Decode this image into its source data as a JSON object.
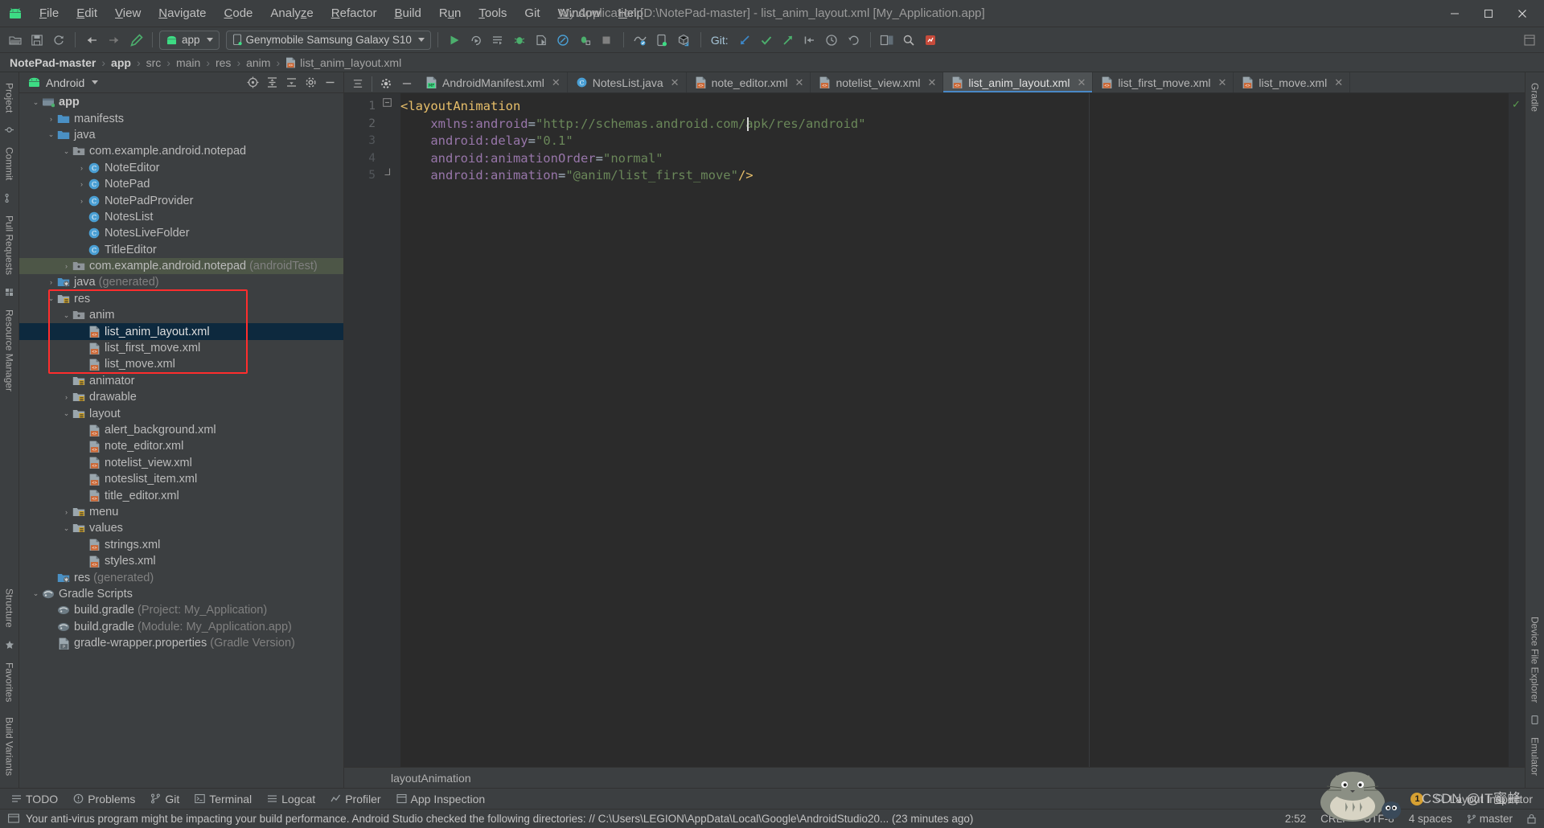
{
  "window": {
    "title": "My Application [D:\\NotePad-master] - list_anim_layout.xml [My_Application.app]",
    "minimize": "—",
    "maximize": "▢",
    "close": "✕",
    "logo_icon": "android-logo-icon"
  },
  "menubar": {
    "items": [
      {
        "label": "File",
        "mnemonic": "F"
      },
      {
        "label": "Edit",
        "mnemonic": "E"
      },
      {
        "label": "View",
        "mnemonic": "V"
      },
      {
        "label": "Navigate",
        "mnemonic": "N"
      },
      {
        "label": "Code",
        "mnemonic": "C"
      },
      {
        "label": "Analyze",
        "mnemonic": "z"
      },
      {
        "label": "Refactor",
        "mnemonic": "R"
      },
      {
        "label": "Build",
        "mnemonic": "B"
      },
      {
        "label": "Run",
        "mnemonic": "u"
      },
      {
        "label": "Tools",
        "mnemonic": "T"
      },
      {
        "label": "Git",
        "mnemonic": ""
      },
      {
        "label": "Window",
        "mnemonic": "W"
      },
      {
        "label": "Help",
        "mnemonic": "H"
      }
    ]
  },
  "toolbar": {
    "open_icon": "open-folder-icon",
    "save_icon": "save-icon",
    "sync_icon": "sync-icon",
    "back_icon": "back-arrow-icon",
    "forward_icon": "forward-arrow-icon",
    "make_icon": "build-hammer-icon",
    "module_selector": "app",
    "module_icon": "android-module-icon",
    "device_selector": "Genymobile Samsung Galaxy S10",
    "device_icon": "phone-icon",
    "run_icon": "run-icon",
    "rerun_icon": "rerun-icon",
    "apply_changes_icon": "apply-changes-icon",
    "debug_icon": "debug-icon",
    "attach_debugger_icon": "attach-debugger-icon",
    "profiler_icon": "profiler-icon",
    "run_coverage_icon": "run-with-coverage-icon",
    "stop_icon": "stop-icon",
    "sdk_manager_icon": "sdk-manager-icon",
    "avd_manager_icon": "avd-manager-icon",
    "layout_inspector_icon": "device-manager-icon",
    "git_label": "Git:",
    "git_update_icon": "git-update-icon",
    "git_commit_icon": "git-commit-icon",
    "git_push_icon": "git-push-icon",
    "git_history_icon": "git-history-icon",
    "history_icon": "history-clock-icon",
    "undo_icon": "undo-icon",
    "device_explorer_icon": "device-file-explorer-icon",
    "search_icon": "search-everywhere-icon",
    "profile_icon": "profiler-red-icon",
    "layout_icon": "layout-icon"
  },
  "breadcrumb": {
    "items": [
      {
        "label": "NotePad-master",
        "bold": true,
        "icon": ""
      },
      {
        "label": "app",
        "bold": true,
        "icon": ""
      },
      {
        "label": "src",
        "bold": false,
        "icon": ""
      },
      {
        "label": "main",
        "bold": false,
        "icon": ""
      },
      {
        "label": "res",
        "bold": false,
        "icon": ""
      },
      {
        "label": "anim",
        "bold": false,
        "icon": ""
      },
      {
        "label": "list_anim_layout.xml",
        "bold": false,
        "icon": "xml-file-icon"
      }
    ],
    "separator": "›"
  },
  "project_panel": {
    "title": "Android",
    "title_icon": "android-head-icon",
    "caret": "▾",
    "header_icons": [
      "target-icon",
      "collapse-all-icon",
      "expand-icon",
      "settings-gear-icon",
      "hide-icon"
    ],
    "tree": [
      {
        "depth": 0,
        "arrow": "v",
        "icon": "module-icon",
        "label": "app",
        "suffix": "",
        "bold": true,
        "state": "normal"
      },
      {
        "depth": 1,
        "arrow": ">",
        "icon": "folder-blue-icon",
        "label": "manifests",
        "suffix": "",
        "bold": false,
        "state": "normal"
      },
      {
        "depth": 1,
        "arrow": "v",
        "icon": "folder-blue-icon",
        "label": "java",
        "suffix": "",
        "bold": false,
        "state": "normal"
      },
      {
        "depth": 2,
        "arrow": "v",
        "icon": "package-icon",
        "label": "com.example.android.notepad",
        "suffix": "",
        "bold": false,
        "state": "normal"
      },
      {
        "depth": 3,
        "arrow": ">",
        "icon": "class-icon",
        "label": "NoteEditor",
        "suffix": "",
        "bold": false,
        "state": "normal"
      },
      {
        "depth": 3,
        "arrow": ">",
        "icon": "class-icon",
        "label": "NotePad",
        "suffix": "",
        "bold": false,
        "state": "normal"
      },
      {
        "depth": 3,
        "arrow": ">",
        "icon": "class-icon",
        "label": "NotePadProvider",
        "suffix": "",
        "bold": false,
        "state": "normal"
      },
      {
        "depth": 3,
        "arrow": "",
        "icon": "class-icon",
        "label": "NotesList",
        "suffix": "",
        "bold": false,
        "state": "normal"
      },
      {
        "depth": 3,
        "arrow": "",
        "icon": "class-icon",
        "label": "NotesLiveFolder",
        "suffix": "",
        "bold": false,
        "state": "normal"
      },
      {
        "depth": 3,
        "arrow": "",
        "icon": "class-icon",
        "label": "TitleEditor",
        "suffix": "",
        "bold": false,
        "state": "normal"
      },
      {
        "depth": 2,
        "arrow": ">",
        "icon": "package-icon",
        "label": "com.example.android.notepad",
        "suffix": " (androidTest)",
        "bold": false,
        "state": "test"
      },
      {
        "depth": 1,
        "arrow": ">",
        "icon": "folder-gen-icon",
        "label": "java",
        "suffix": " (generated)",
        "bold": false,
        "state": "normal"
      },
      {
        "depth": 1,
        "arrow": "v",
        "icon": "folder-res-icon",
        "label": "res",
        "suffix": "",
        "bold": false,
        "state": "normal"
      },
      {
        "depth": 2,
        "arrow": "v",
        "icon": "package-icon",
        "label": "anim",
        "suffix": "",
        "bold": false,
        "state": "normal"
      },
      {
        "depth": 3,
        "arrow": "",
        "icon": "xml-file-icon",
        "label": "list_anim_layout.xml",
        "suffix": "",
        "bold": false,
        "state": "selected"
      },
      {
        "depth": 3,
        "arrow": "",
        "icon": "xml-file-icon",
        "label": "list_first_move.xml",
        "suffix": "",
        "bold": false,
        "state": "normal"
      },
      {
        "depth": 3,
        "arrow": "",
        "icon": "xml-file-icon",
        "label": "list_move.xml",
        "suffix": "",
        "bold": false,
        "state": "normal"
      },
      {
        "depth": 2,
        "arrow": "",
        "icon": "folder-res-icon",
        "label": "animator",
        "suffix": "",
        "bold": false,
        "state": "normal"
      },
      {
        "depth": 2,
        "arrow": ">",
        "icon": "folder-res-icon",
        "label": "drawable",
        "suffix": "",
        "bold": false,
        "state": "normal"
      },
      {
        "depth": 2,
        "arrow": "v",
        "icon": "folder-res-icon",
        "label": "layout",
        "suffix": "",
        "bold": false,
        "state": "normal"
      },
      {
        "depth": 3,
        "arrow": "",
        "icon": "xml-file-icon",
        "label": "alert_background.xml",
        "suffix": "",
        "bold": false,
        "state": "normal"
      },
      {
        "depth": 3,
        "arrow": "",
        "icon": "xml-file-icon",
        "label": "note_editor.xml",
        "suffix": "",
        "bold": false,
        "state": "normal"
      },
      {
        "depth": 3,
        "arrow": "",
        "icon": "xml-file-icon",
        "label": "notelist_view.xml",
        "suffix": "",
        "bold": false,
        "state": "normal"
      },
      {
        "depth": 3,
        "arrow": "",
        "icon": "xml-file-icon",
        "label": "noteslist_item.xml",
        "suffix": "",
        "bold": false,
        "state": "normal"
      },
      {
        "depth": 3,
        "arrow": "",
        "icon": "xml-file-icon",
        "label": "title_editor.xml",
        "suffix": "",
        "bold": false,
        "state": "normal"
      },
      {
        "depth": 2,
        "arrow": ">",
        "icon": "folder-res-icon",
        "label": "menu",
        "suffix": "",
        "bold": false,
        "state": "normal"
      },
      {
        "depth": 2,
        "arrow": "v",
        "icon": "folder-res-icon",
        "label": "values",
        "suffix": "",
        "bold": false,
        "state": "normal"
      },
      {
        "depth": 3,
        "arrow": "",
        "icon": "xml-file-icon",
        "label": "strings.xml",
        "suffix": "",
        "bold": false,
        "state": "normal"
      },
      {
        "depth": 3,
        "arrow": "",
        "icon": "xml-file-icon",
        "label": "styles.xml",
        "suffix": "",
        "bold": false,
        "state": "normal"
      },
      {
        "depth": 1,
        "arrow": "",
        "icon": "folder-gen-icon",
        "label": "res",
        "suffix": " (generated)",
        "bold": false,
        "state": "normal"
      },
      {
        "depth": 0,
        "arrow": "v",
        "icon": "gradle-icon",
        "label": "Gradle Scripts",
        "suffix": "",
        "bold": false,
        "state": "normal"
      },
      {
        "depth": 1,
        "arrow": "",
        "icon": "gradle-file-icon",
        "label": "build.gradle",
        "suffix": " (Project: My_Application)",
        "bold": false,
        "state": "normal"
      },
      {
        "depth": 1,
        "arrow": "",
        "icon": "gradle-file-icon",
        "label": "build.gradle",
        "suffix": " (Module: My_Application.app)",
        "bold": false,
        "state": "normal"
      },
      {
        "depth": 1,
        "arrow": "",
        "icon": "props-file-icon",
        "label": "gradle-wrapper.properties",
        "suffix": " (Gradle Version)",
        "bold": false,
        "state": "normal"
      }
    ],
    "highlight_color": "#ff2d2d"
  },
  "left_rail": {
    "items": [
      "Project",
      "Commit",
      "Pull Requests",
      "Resource Manager",
      "Structure",
      "Favorites",
      "Build Variants"
    ]
  },
  "right_rail": {
    "items": [
      "Gradle",
      "Device File Explorer",
      "Emulator"
    ]
  },
  "editor": {
    "tabs": [
      {
        "label": "AndroidManifest.xml",
        "icon": "manifest-file-icon",
        "active": false,
        "close": "✕"
      },
      {
        "label": "NotesList.java",
        "icon": "java-class-icon",
        "active": false,
        "close": "✕"
      },
      {
        "label": "note_editor.xml",
        "icon": "xml-file-icon",
        "active": false,
        "close": "✕"
      },
      {
        "label": "notelist_view.xml",
        "icon": "xml-file-icon",
        "active": false,
        "close": "✕"
      },
      {
        "label": "list_anim_layout.xml",
        "icon": "xml-file-icon",
        "active": true,
        "close": "✕"
      },
      {
        "label": "list_first_move.xml",
        "icon": "xml-file-icon",
        "active": false,
        "close": "✕"
      },
      {
        "label": "list_move.xml",
        "icon": "xml-file-icon",
        "active": false,
        "close": "✕"
      }
    ],
    "line_numbers": [
      "1",
      "2",
      "3",
      "4",
      "5"
    ],
    "code_lines": [
      {
        "n": 1,
        "fold": "−",
        "bulb": false,
        "tokens": [
          {
            "t": "<layoutAnimation",
            "c": "t-tag"
          }
        ]
      },
      {
        "n": 2,
        "fold": "",
        "bulb": true,
        "tokens": [
          {
            "t": "    ",
            "c": "t-pun"
          },
          {
            "t": "xmlns:android",
            "c": "t-attr"
          },
          {
            "t": "=",
            "c": "t-pun"
          },
          {
            "t": "\"http://schemas.android.com/apk/res/android\"",
            "c": "t-str"
          }
        ]
      },
      {
        "n": 3,
        "fold": "",
        "bulb": false,
        "tokens": [
          {
            "t": "    ",
            "c": "t-pun"
          },
          {
            "t": "android:delay",
            "c": "t-attr"
          },
          {
            "t": "=",
            "c": "t-pun"
          },
          {
            "t": "\"0.1\"",
            "c": "t-str"
          }
        ]
      },
      {
        "n": 4,
        "fold": "",
        "bulb": false,
        "tokens": [
          {
            "t": "    ",
            "c": "t-pun"
          },
          {
            "t": "android:animationOrder",
            "c": "t-attr"
          },
          {
            "t": "=",
            "c": "t-pun"
          },
          {
            "t": "\"normal\"",
            "c": "t-str"
          }
        ]
      },
      {
        "n": 5,
        "fold": "⌐",
        "bulb": false,
        "tokens": [
          {
            "t": "    ",
            "c": "t-pun"
          },
          {
            "t": "android:animation",
            "c": "t-attr"
          },
          {
            "t": "=",
            "c": "t-pun"
          },
          {
            "t": "\"@anim/list_first_move\"",
            "c": "t-str"
          },
          {
            "t": "/>",
            "c": "t-tag"
          }
        ]
      }
    ],
    "inspection_ok": "✓",
    "status_text": "layoutAnimation"
  },
  "bottom_tools": {
    "items": [
      {
        "label": "TODO",
        "icon": "todo-icon"
      },
      {
        "label": "Problems",
        "icon": "problems-icon"
      },
      {
        "label": "Git",
        "icon": "git-branch-icon"
      },
      {
        "label": "Terminal",
        "icon": "terminal-icon"
      },
      {
        "label": "Logcat",
        "icon": "logcat-icon"
      },
      {
        "label": "Profiler",
        "icon": "profiler-icon"
      },
      {
        "label": "App Inspection",
        "icon": "app-inspection-icon"
      }
    ],
    "right": {
      "badge_count": "1",
      "layout_inspector": "Layout Inspector",
      "layout_inspector_icon": "layout-inspector-icon"
    }
  },
  "statusbar": {
    "menu_icon": "hamburger-icon",
    "message": "Your anti-virus program might be impacting your build performance. Android Studio checked the following directories: // C:\\Users\\LEGION\\AppData\\Local\\Google\\AndroidStudio20... (23 minutes ago)",
    "caret_position": "2:52",
    "line_separator": "CRLF",
    "encoding": "UTF-8",
    "indent": "4 spaces",
    "branch_icon": "git-branch-icon",
    "branch": "master",
    "lock_icon": "lock-icon"
  },
  "watermark": {
    "text": "CSDN @IT蜜蜂",
    "totoro_icon": "totoro-mascot-icon"
  },
  "colors": {
    "accent_blue": "#4a88c7",
    "selection_blue": "#0d293e",
    "android_green": "#3ddc84",
    "xml_orange": "#cc6633",
    "panel_bg": "#3c3f41",
    "editor_bg": "#2b2b2b",
    "highlight_red": "#ff2d2d",
    "string_green": "#6a8759",
    "attr_purple": "#9876aa",
    "tag_yellow": "#e8bf6a"
  }
}
